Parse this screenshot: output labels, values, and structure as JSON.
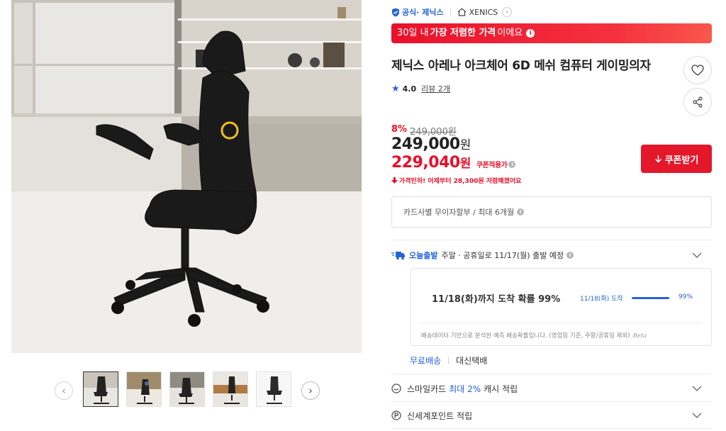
{
  "gallery": {
    "prev_icon": "chevron-left-icon",
    "next_icon": "chevron-right-icon",
    "thumbnail_count": 5,
    "active_thumbnail": 1
  },
  "store": {
    "badge_label": "공식· 제닉스",
    "badge_icon": "shield-check-icon",
    "store_name": "XENICS",
    "store_icon": "house-icon"
  },
  "promo": {
    "text_before": "30일 내",
    "text_strong": "가장 저렴한 가격",
    "text_after": "이에요",
    "background": "#e8102a"
  },
  "product": {
    "title": "제닉스 아레나 아크체어 6D 메쉬 컴퓨터 게이밍의자",
    "rating": "4.0",
    "review_label": "리뷰 2개"
  },
  "price": {
    "discount_rate": "8%",
    "original_price": "249,000원",
    "sale_price": "249,000",
    "sale_unit": "원",
    "coupon_price": "229,040",
    "coupon_unit": "원",
    "coupon_tag": "쿠폰적용가",
    "drop_notice": "가격인하! 어제부터 28,300원 저렴해졌어요"
  },
  "coupon_button": {
    "label": "쿠폰받기",
    "icon": "download-arrow-icon",
    "color": "#e3182b"
  },
  "installment": {
    "text": "카드사별 무이자할부 / 최대 6개월"
  },
  "shipping": {
    "today_label": "오늘출발",
    "schedule": "주말 · 공휴일로 11/17(월) 출발 예정",
    "forecast_headline": "11/18(화)까지 도착 확률 99%",
    "forecast_date": "11/18(화) 도착",
    "forecast_percent": "99%",
    "forecast_probability": 0.99,
    "forecast_note": "배송데이터 기반으로 분석한 예측 배송확률입니다. (영업일 기준, 주말/공휴일 제외)",
    "beta_label": "Beta",
    "free_label": "무료배송",
    "courier": "대신택배"
  },
  "benefits": {
    "smile_card_prefix": "스마일카드",
    "smile_card_strong": "최대 2%",
    "smile_card_suffix": "캐시 적립",
    "shinsegae_label": "신세계포인트 적립"
  },
  "colors": {
    "accent_blue": "#2563d9",
    "accent_red": "#e8102a"
  }
}
